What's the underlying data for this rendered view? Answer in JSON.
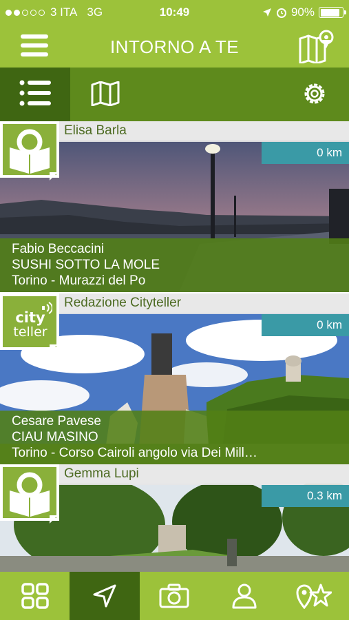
{
  "status_bar": {
    "carrier": "3 ITA",
    "network": "3G",
    "time": "10:49",
    "battery": "90%",
    "battery_level": 0.9
  },
  "header": {
    "title": "INTORNO A TE",
    "menu_icon": "hamburger-icon",
    "map_icon": "map-pin-icon"
  },
  "toolbar": {
    "list_icon": "list-icon",
    "map_icon": "map-icon",
    "settings_icon": "gear-icon"
  },
  "stories": [
    {
      "author": "Elisa Barla",
      "distance": "0 km",
      "narrator": "Fabio Beccacini",
      "title": "SUSHI SOTTO LA MOLE",
      "place": "Torino - Murazzi del Po",
      "avatar_icon": "reader-icon"
    },
    {
      "author": "Redazione Cityteller",
      "distance": "0 km",
      "narrator": "Cesare Pavese",
      "title": "CIAU MASINO",
      "place": "Torino - Corso Cairoli angolo via Dei Mill…",
      "avatar_icon": "cityteller-logo",
      "avatar_text_1": "city",
      "avatar_text_2": "teller"
    },
    {
      "author": "Gemma Lupi",
      "distance": "0.3 km",
      "avatar_icon": "reader-icon"
    }
  ],
  "bottom_nav": {
    "items": [
      "grid-icon",
      "navigation-arrow-icon",
      "camera-icon",
      "user-icon",
      "location-star-icon"
    ],
    "active": "navigation-arrow-icon"
  },
  "colors": {
    "brand_green": "#9cc23a",
    "toolbar_green": "#5e8a1c",
    "active_green": "#3f6612",
    "distance_teal": "#3a9aa6"
  }
}
